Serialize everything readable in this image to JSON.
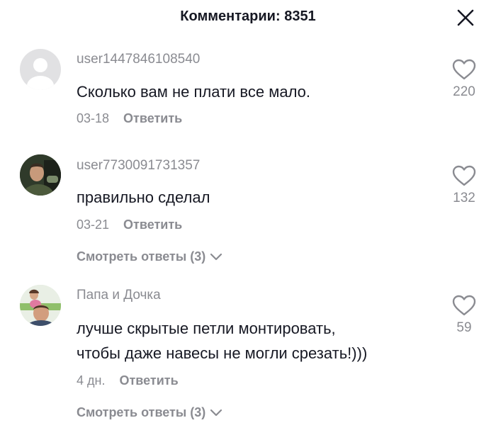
{
  "header": {
    "title": "Комментарии: 8351"
  },
  "icons": {
    "close": "close-icon",
    "like": "heart-outline-icon",
    "chevron": "chevron-down-icon",
    "avatar_default": "default-avatar-icon"
  },
  "colors": {
    "primary_text": "#161823",
    "secondary_text": "#8a8b91"
  },
  "comments": [
    {
      "username": "user1447846108540",
      "text": "Сколько вам не плати все мало.",
      "date": "03-18",
      "reply_label": "Ответить",
      "likes": "220",
      "view_replies": ""
    },
    {
      "username": "user7730091731357",
      "text": "правильно сделал",
      "date": "03-21",
      "reply_label": "Ответить",
      "likes": "132",
      "view_replies": "Смотреть ответы (3)"
    },
    {
      "username": "Папа и Дочка",
      "text_line1": "лучше скрытые петли монтировать,",
      "text_line2": "чтобы даже навесы не могли срезать!)))",
      "date": "4 дн.",
      "reply_label": "Ответить",
      "likes": "59",
      "view_replies": "Смотреть ответы (3)"
    }
  ]
}
